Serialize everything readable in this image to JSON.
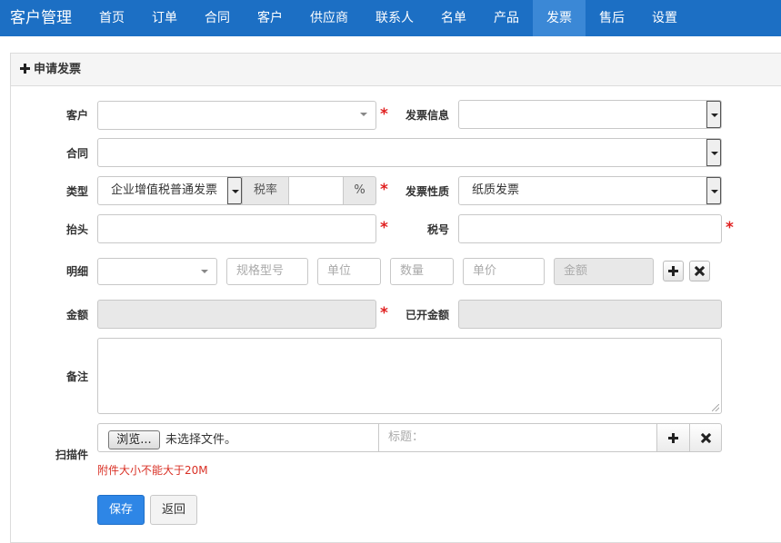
{
  "app": {
    "brand": "客户管理"
  },
  "nav": {
    "items": [
      "首页",
      "订单",
      "合同",
      "客户",
      "供应商",
      "联系人",
      "名单",
      "产品",
      "发票",
      "售后",
      "设置"
    ],
    "active": "发票"
  },
  "panel": {
    "title": "申请发票"
  },
  "form": {
    "customer": {
      "label": "客户",
      "value": ""
    },
    "invoice_info": {
      "label": "发票信息",
      "value": ""
    },
    "contract": {
      "label": "合同",
      "value": ""
    },
    "type": {
      "label": "类型",
      "value": "企业增值税普通发票",
      "tax_rate_label": "税率",
      "tax_rate_value": "",
      "percent": "%"
    },
    "invoice_nature": {
      "label": "发票性质",
      "value": "纸质发票"
    },
    "title_field": {
      "label": "抬头",
      "value": ""
    },
    "tax_number": {
      "label": "税号",
      "value": ""
    },
    "detail": {
      "label": "明细",
      "product_value": "",
      "spec_placeholder": "规格型号",
      "unit_placeholder": "单位",
      "quantity_placeholder": "数量",
      "price_placeholder": "单价",
      "amount_placeholder": "金额"
    },
    "amount": {
      "label": "金额",
      "value": ""
    },
    "invoiced_amount": {
      "label": "已开金额",
      "value": ""
    },
    "remark": {
      "label": "备注",
      "value": ""
    },
    "scan": {
      "label": "扫描件",
      "browse_label": "浏览...",
      "no_file_text": "未选择文件。",
      "title_placeholder": "标题："
    },
    "size_note": "附件大小不能大于20M",
    "required_mark": "*"
  },
  "actions": {
    "save_label": "保存",
    "back_label": "返回"
  },
  "colors": {
    "navbar": "#1c6fc4",
    "nav_active": "#3b88d6",
    "primary": "#2e86e6",
    "required": "#e02020",
    "note": "#d93025"
  }
}
